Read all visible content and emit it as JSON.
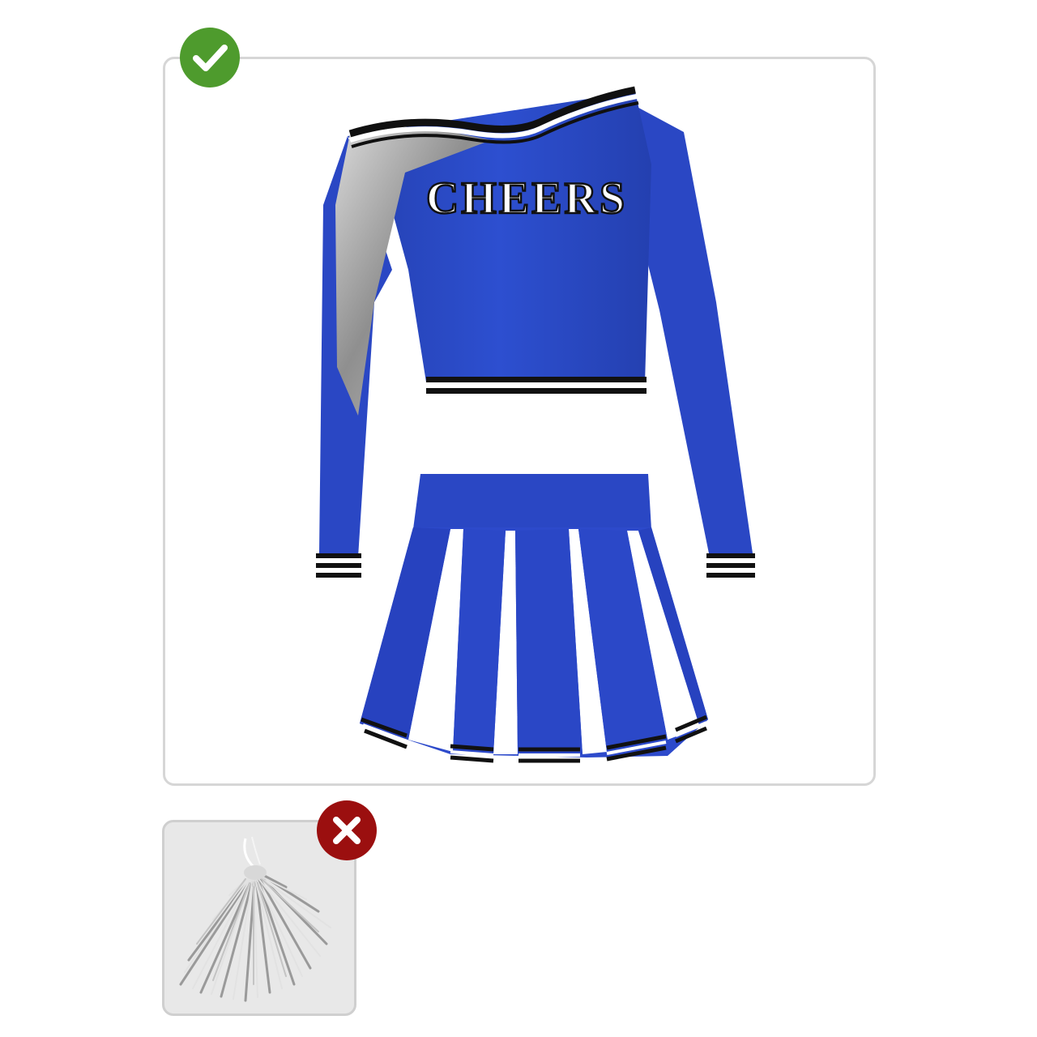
{
  "included": {
    "status_icon": "check-icon",
    "status_color": "#4e9b2d",
    "product": "cheerleader-uniform",
    "top_print": "CHEERS",
    "uniform_color": "#1f3fb8",
    "accent_color": "#a8a8a8"
  },
  "excluded": {
    "status_icon": "x-icon",
    "status_color": "#9b0f0f",
    "product": "pom-pom",
    "product_color": "#bfbfbf"
  }
}
